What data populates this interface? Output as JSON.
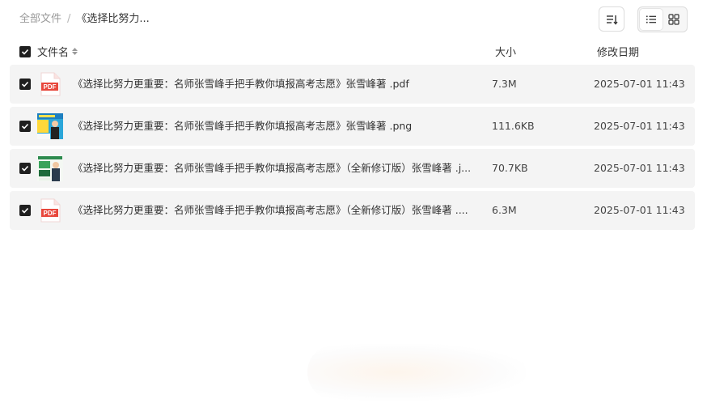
{
  "breadcrumb": {
    "root": "全部文件",
    "separator": "/",
    "current": "《选择比努力..."
  },
  "toolbar": {
    "sort_icon": "sort-descending-icon",
    "list_view_icon": "list-view-icon",
    "grid_view_icon": "grid-view-icon",
    "active_view": "list"
  },
  "table": {
    "columns": {
      "name": "文件名",
      "size": "大小",
      "date": "修改日期"
    },
    "rows": [
      {
        "name": "《选择比努力更重要：名师张雪峰手把手教你填报高考志愿》张雪峰著 .pdf",
        "size": "7.3M",
        "date": "2025-07-01 11:43",
        "icon": "pdf-file-icon",
        "checked": true
      },
      {
        "name": "《选择比努力更重要：名师张雪峰手把手教你填报高考志愿》张雪峰著 .png",
        "size": "111.6KB",
        "date": "2025-07-01 11:43",
        "icon": "image-thumbnail-icon",
        "checked": true
      },
      {
        "name": "《选择比努力更重要：名师张雪峰手把手教你填报高考志愿》（全新修订版）张雪峰著 .j...",
        "size": "70.7KB",
        "date": "2025-07-01 11:43",
        "icon": "image-thumbnail-icon",
        "checked": true
      },
      {
        "name": "《选择比努力更重要：名师张雪峰手把手教你填报高考志愿》（全新修订版）张雪峰著 ....",
        "size": "6.3M",
        "date": "2025-07-01 11:43",
        "icon": "pdf-file-icon",
        "checked": true
      }
    ]
  },
  "colors": {
    "pdf_red": "#e8473c",
    "checkbox": "#1f1f1f",
    "row_bg": "#f4f4f4"
  }
}
